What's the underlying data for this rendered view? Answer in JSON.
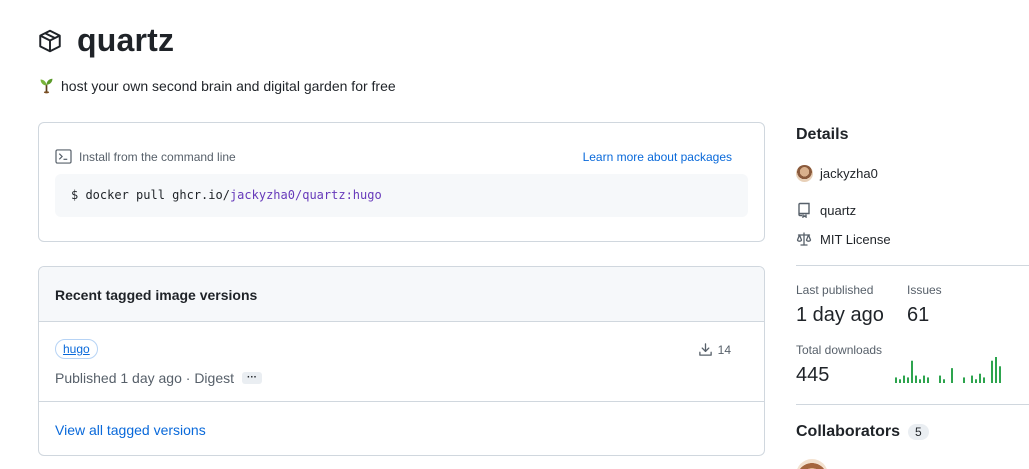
{
  "package": {
    "name": "quartz",
    "description": "host your own second brain and digital garden for free",
    "icon": "package-icon",
    "desc_icon": "seedling-icon"
  },
  "install": {
    "heading": "Install from the command line",
    "learn_more": "Learn more about packages",
    "command_prefix": "$ docker pull ghcr.io/",
    "command_owner": "jackyzha0",
    "command_sep": "/",
    "command_image": "quartz:hugo"
  },
  "versions": {
    "heading": "Recent tagged image versions",
    "items": [
      {
        "tag": "hugo",
        "published": "Published 1 day ago · Digest",
        "more_label": "···",
        "downloads": "14"
      }
    ],
    "view_all": "View all tagged versions"
  },
  "sidebar": {
    "details_title": "Details",
    "owner": "jackyzha0",
    "repo": "quartz",
    "license": "MIT License",
    "last_published_label": "Last published",
    "last_published_value": "1 day ago",
    "issues_label": "Issues",
    "issues_value": "61",
    "downloads_label": "Total downloads",
    "downloads_value": "445",
    "collaborators_title": "Collaborators",
    "collaborators_count": "5"
  },
  "colors": {
    "link": "#0969da",
    "sparkline": "#2da44e",
    "border": "#d0d7de",
    "muted": "#57606a"
  },
  "download_sparkline": [
    3,
    2,
    4,
    3,
    12,
    4,
    2,
    4,
    3,
    0,
    0,
    4,
    2,
    0,
    8,
    0,
    0,
    3,
    0,
    4,
    2,
    5,
    3,
    0,
    12,
    14,
    9
  ]
}
